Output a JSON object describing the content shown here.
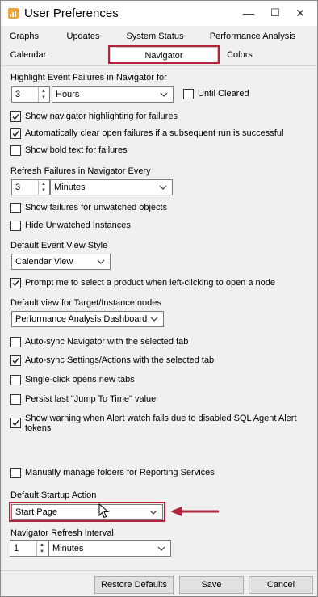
{
  "window": {
    "title": "User Preferences",
    "minimize_glyph": "—",
    "maximize_glyph": "☐",
    "close_glyph": "✕"
  },
  "tabs": {
    "row1": [
      "Graphs",
      "Updates",
      "System Status",
      "Performance Analysis"
    ],
    "row2": [
      "Calendar",
      "Navigator",
      "Colors"
    ],
    "active": "Navigator"
  },
  "highlight": {
    "label": "Highlight Event Failures in Navigator for",
    "value": "3",
    "unit": "Hours",
    "until_cleared_label": "Until Cleared",
    "until_cleared_checked": false
  },
  "options_a": [
    {
      "label": "Show navigator highlighting for failures",
      "checked": true
    },
    {
      "label": "Automatically clear open failures if a subsequent run is successful",
      "checked": true
    },
    {
      "label": "Show bold text for failures",
      "checked": false
    }
  ],
  "refresh": {
    "label": "Refresh Failures in Navigator Every",
    "value": "3",
    "unit": "Minutes"
  },
  "options_b": [
    {
      "label": "Show failures for unwatched objects",
      "checked": false
    },
    {
      "label": "Hide Unwatched Instances",
      "checked": false
    }
  ],
  "event_view": {
    "label": "Default Event View Style",
    "value": "Calendar View"
  },
  "prompt_product": {
    "label": "Prompt me to select a product when left-clicking to open a node",
    "checked": true
  },
  "target_view": {
    "label": "Default view for Target/Instance nodes",
    "value": "Performance Analysis Dashboard"
  },
  "options_c": [
    {
      "label": "Auto-sync Navigator with the selected tab",
      "checked": false
    },
    {
      "label": "Auto-sync Settings/Actions with the selected tab",
      "checked": true
    },
    {
      "label": "Single-click opens new tabs",
      "checked": false
    },
    {
      "label": "Persist last \"Jump To Time\" value",
      "checked": false
    }
  ],
  "alert_warning": {
    "line1": "Show warning when Alert watch fails due to disabled SQL Agent Alert",
    "line2": "tokens",
    "checked": true
  },
  "reporting": {
    "label": "Manually manage folders for Reporting Services",
    "checked": false
  },
  "startup": {
    "label": "Default Startup Action",
    "value": "Start Page"
  },
  "nav_refresh": {
    "label": "Navigator Refresh Interval",
    "value": "1",
    "unit": "Minutes"
  },
  "buttons": {
    "restore": "Restore Defaults",
    "save": "Save",
    "cancel": "Cancel"
  },
  "colors": {
    "annotation_red": "#b5233b",
    "app_icon_orange": "#f2a33a"
  }
}
